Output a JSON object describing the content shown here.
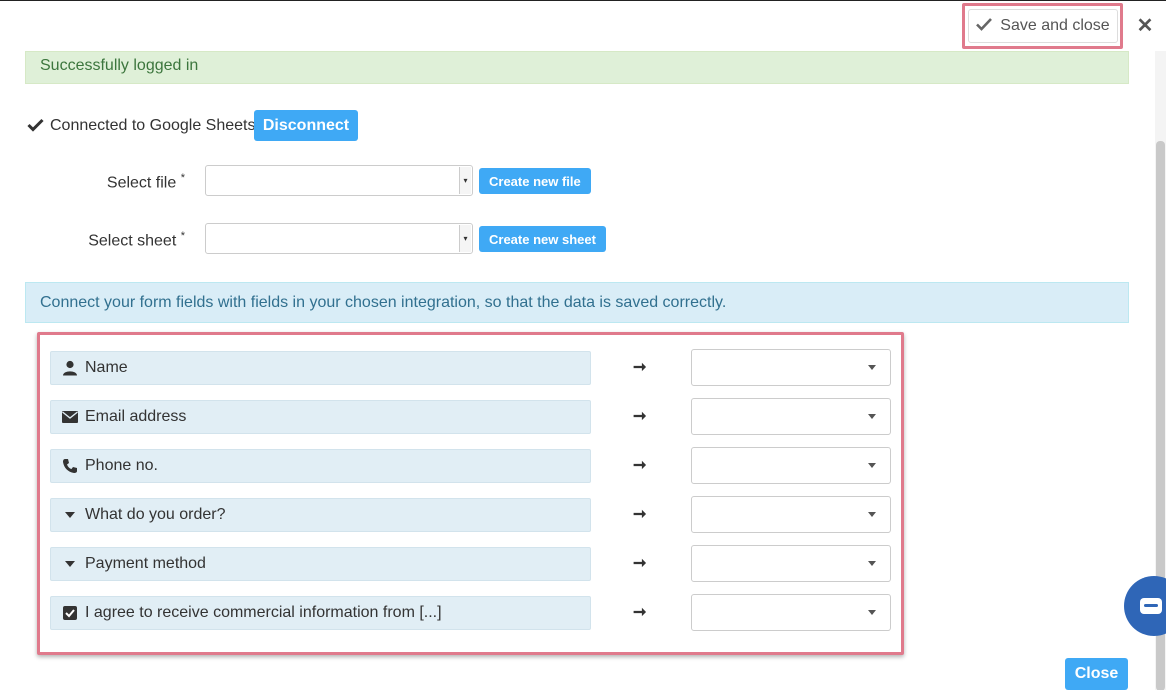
{
  "topbar": {
    "save_label": "Save and close",
    "close_glyph": "✕"
  },
  "status": {
    "success": "Successfully logged in",
    "connected": "Connected to Google Sheets",
    "disconnect_label": "Disconnect"
  },
  "file": {
    "label": "Select file",
    "required": "*",
    "value": "",
    "create_label": "Create new file"
  },
  "sheet": {
    "label": "Select sheet",
    "required": "*",
    "value": "",
    "create_label": "Create new sheet"
  },
  "info": {
    "text": "Connect your form fields with fields in your chosen integration, so that the data is saved correctly."
  },
  "mappings": [
    {
      "icon": "user-icon",
      "label": "Name",
      "value": ""
    },
    {
      "icon": "envelope-icon",
      "label": "Email address",
      "value": ""
    },
    {
      "icon": "phone-icon",
      "label": "Phone no.",
      "value": ""
    },
    {
      "icon": "caret-down-icon",
      "label": "What do you order?",
      "value": ""
    },
    {
      "icon": "caret-down-icon",
      "label": "Payment method",
      "value": ""
    },
    {
      "icon": "checkbox-icon",
      "label": "I agree to receive commercial information from [...]",
      "value": ""
    }
  ],
  "footer": {
    "close_label": "Close"
  },
  "colors": {
    "accent": "#3fa9f5",
    "highlight": "#e07a8c",
    "success_bg": "#dff0d8",
    "info_bg": "#d9edf7"
  }
}
